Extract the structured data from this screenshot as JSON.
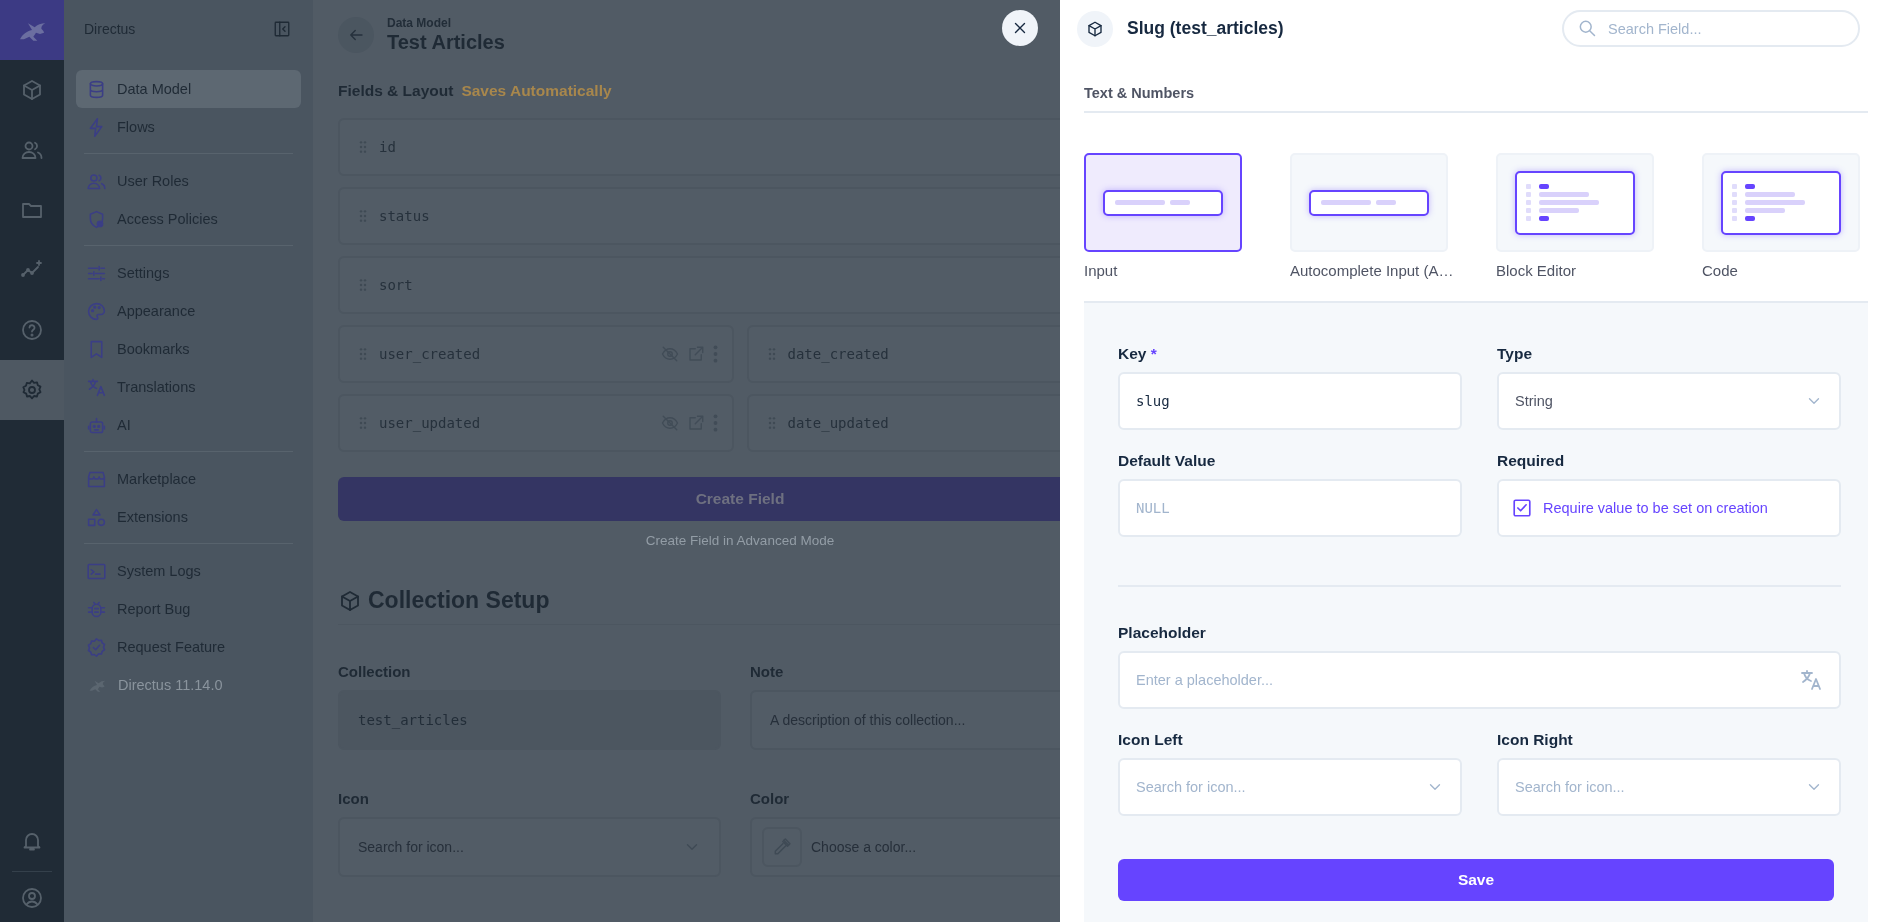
{
  "rail": {
    "items": [
      {
        "selected": false
      },
      {
        "selected": false
      },
      {
        "selected": false
      },
      {
        "selected": false
      },
      {
        "selected": false
      },
      {
        "selected": true
      }
    ]
  },
  "nav": {
    "title": "Directus",
    "groups": [
      {
        "items": [
          {
            "label": "Data Model",
            "selected": true
          },
          {
            "label": "Flows",
            "selected": false
          }
        ]
      },
      {
        "items": [
          {
            "label": "User Roles",
            "selected": false
          },
          {
            "label": "Access Policies",
            "selected": false
          }
        ]
      },
      {
        "items": [
          {
            "label": "Settings",
            "selected": false
          },
          {
            "label": "Appearance",
            "selected": false
          },
          {
            "label": "Bookmarks",
            "selected": false
          },
          {
            "label": "Translations",
            "selected": false
          },
          {
            "label": "AI",
            "selected": false
          }
        ]
      },
      {
        "items": [
          {
            "label": "Marketplace",
            "selected": false
          },
          {
            "label": "Extensions",
            "selected": false
          }
        ]
      },
      {
        "items": [
          {
            "label": "System Logs",
            "selected": false
          },
          {
            "label": "Report Bug",
            "selected": false
          },
          {
            "label": "Request Feature",
            "selected": false
          }
        ]
      }
    ],
    "version": "Directus 11.14.0"
  },
  "main": {
    "breadcrumb": "Data Model",
    "title": "Test Articles",
    "section": "Fields & Layout",
    "save_status": "Saves Automatically",
    "fields": [
      {
        "name": "id",
        "kind": "full"
      },
      {
        "name": "status",
        "kind": "full"
      },
      {
        "name": "sort",
        "kind": "full"
      },
      {
        "name": "user_created",
        "kind": "half",
        "hidden": true
      },
      {
        "name": "date_created",
        "kind": "half"
      },
      {
        "name": "user_updated",
        "kind": "half",
        "hidden": true
      },
      {
        "name": "date_updated",
        "kind": "half"
      }
    ],
    "create_button": "Create Field",
    "advanced_link": "Create Field in Advanced Mode",
    "setup": {
      "title": "Collection Setup",
      "collection": {
        "label": "Collection",
        "value": "test_articles"
      },
      "note": {
        "label": "Note",
        "placeholder": "A description of this collection..."
      },
      "icon": {
        "label": "Icon",
        "placeholder": "Search for icon..."
      },
      "color": {
        "label": "Color",
        "placeholder": "Choose a color..."
      }
    }
  },
  "drawer": {
    "title": "Slug (test_articles)",
    "search": {
      "placeholder": "Search Field..."
    },
    "group": "Text & Numbers",
    "interfaces": [
      {
        "label": "Input",
        "kind": "input",
        "selected": true
      },
      {
        "label": "Autocomplete Input (A…",
        "kind": "input",
        "selected": false
      },
      {
        "label": "Block Editor",
        "kind": "block",
        "selected": false
      },
      {
        "label": "Code",
        "kind": "block",
        "selected": false
      }
    ],
    "key": {
      "label": "Key",
      "required_mark": "*",
      "value": "slug"
    },
    "type": {
      "label": "Type",
      "value": "String"
    },
    "default_value": {
      "label": "Default Value",
      "placeholder": "NULL"
    },
    "required": {
      "label": "Required",
      "checkbox_label": "Require value to be set on creation",
      "checked": true
    },
    "placeholder": {
      "label": "Placeholder",
      "placeholder": "Enter a placeholder..."
    },
    "icon_left": {
      "label": "Icon Left",
      "placeholder": "Search for icon..."
    },
    "icon_right": {
      "label": "Icon Right",
      "placeholder": "Search for icon..."
    },
    "save_button": "Save"
  }
}
